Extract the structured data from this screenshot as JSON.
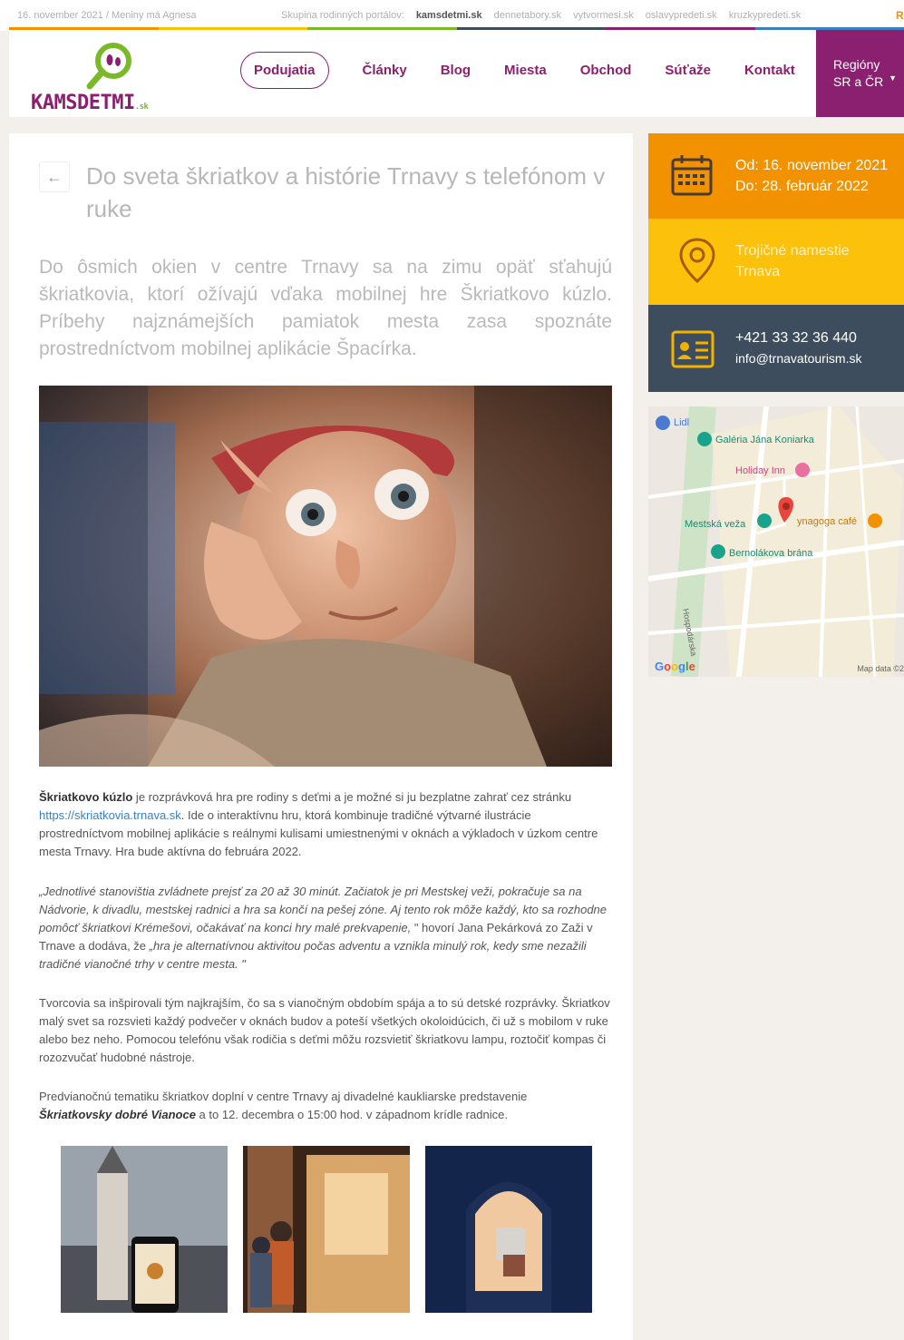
{
  "topbar": {
    "date_text": "16. november 2021 / Meniny má Agnesa",
    "portals_label": "Skupina rodinných portálov:",
    "portals": [
      "kamsdetmi.sk",
      "dennetabory.sk",
      "vytvormesi.sk",
      "oslavypredeti.sk",
      "kruzkypredeti.sk"
    ],
    "trailing_letter": "R"
  },
  "colors": {
    "brand_purple": "#8b1f70",
    "brand_green": "#7ab929",
    "orange": "#f39200",
    "yellow": "#fcc10a",
    "dark_slate": "#3d4d5d",
    "strip": [
      "#f39200",
      "#fcc10a",
      "#7ab929",
      "#3d4d5d",
      "#8b1f70",
      "#3c7fbf"
    ]
  },
  "header": {
    "logo_text": "KAMSDETMI",
    "logo_suffix": ".sk",
    "nav": [
      "Podujatia",
      "Články",
      "Blog",
      "Miesta",
      "Obchod",
      "Súťaže",
      "Kontakt"
    ],
    "regions_line1": "Regióny",
    "regions_line2": "SR a ČR"
  },
  "article": {
    "back_icon": "arrow-left-icon",
    "title": "Do sveta škriatkov a histórie Trnavy s telefónom v ruke",
    "lead": "Do ôsmich okien v centre Trnavy sa na zimu opäť sťahujú škriatkovia, ktorí ožívajú vďaka mobilnej hre Škriatkovo kúzlo. Príbehy najznámejších pamiatok mesta zasa spoznáte prostredníctvom mobilnej aplikácie Špacírka.",
    "p1_bold": "Škriatkovo kúzlo",
    "p1_a": " je rozprávková hra pre rodiny s deťmi a je možné si ju bezplatne zahrať cez stránku ",
    "p1_link": "https://skriatkovia.trnava.sk",
    "p1_b": ". Ide o interaktívnu hru, ktorá kombinuje tradičné výtvarné ilustrácie prostredníctvom mobilnej aplikácie s reálnymi kulisami umiestnenými v oknách a výkladoch v úzkom centre mesta Trnavy. Hra bude aktívna do februára 2022.",
    "p2_italic_a": "„Jednotlivé stanovištia zvládnete prejsť za 20 až 30 minút. Začiatok je pri Mestskej veži, pokračuje sa na Nádvorie, k divadlu, mestskej radnici a hra sa končí na pešej zóne. Aj tento rok môže každý, kto sa rozhodne pomôcť škriatkovi Krémešovi, očakávať na konci hry malé prekvapenie,",
    "p2_plain": " \" hovorí Jana Pekárková zo Zaži v Trnave a dodáva, že ",
    "p2_italic_b": "„hra je alternatívnou aktivitou počas adventu a vznikla minulý rok, kedy sme nezažili tradičné vianočné trhy v centre mesta. \"",
    "p3": "Tvorcovia sa inšpirovali tým najkrajším, čo sa s vianočným obdobím spája a to sú detské rozprávky. Škriatkov malý svet sa rozsvieti každý podvečer v oknách budov a poteší všetkých okoloidúcich, či už s mobilom v ruke alebo bez neho. Pomocou telefónu však rodičia s deťmi môžu rozsvietiť škriatkovu lampu, roztočiť kompas či rozozvučať hudobné nástroje.",
    "p4_a": "Predvianočnú tematiku škriatkov doplní v centre Trnavy aj divadelné kaukliarske predstavenie ",
    "p4_bold": "Škriatkovsky dobré Vianoce",
    "p4_b": " a to 12. decembra o 15:00 hod. v západnom krídle radnice."
  },
  "sidebar": {
    "date_from": "Od: 16. november 2021",
    "date_to": "Do: 28. február 2022",
    "loc_line1": "Trojičné namestie",
    "loc_line2": "Trnava",
    "phone": "+421 33 32 36 440",
    "email": "info@trnavatourism.sk"
  },
  "map": {
    "labels": [
      "Lidl",
      "Galéria Jána Koniarka",
      "Holiday Inn",
      "Mestská veža",
      "ynagoga café",
      "Bernolákova brána",
      "Hospodárska"
    ],
    "google": "Google",
    "mapdata": "Map data ©2"
  }
}
